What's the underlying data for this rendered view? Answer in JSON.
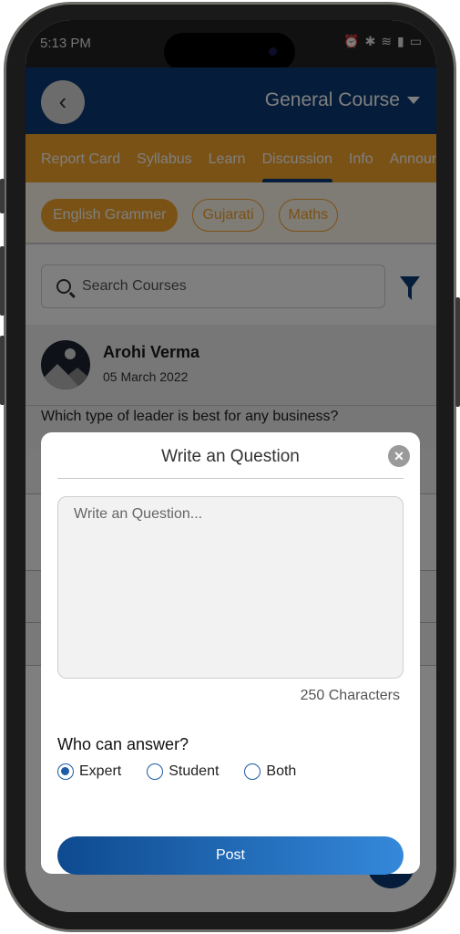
{
  "status_bar": {
    "time": "5:13 PM",
    "icons": [
      "alarm-icon",
      "bluetooth-icon",
      "wifi-icon",
      "signal-icon",
      "battery-icon"
    ]
  },
  "header": {
    "back_icon": "chevron-left-icon",
    "course_title": "General Course",
    "dropdown_icon": "caret-down-icon"
  },
  "tabs": [
    {
      "label": "Report Card",
      "active": false
    },
    {
      "label": "Syllabus",
      "active": false
    },
    {
      "label": "Learn",
      "active": false
    },
    {
      "label": "Discussion",
      "active": true
    },
    {
      "label": "Info",
      "active": false
    },
    {
      "label": "Announcements",
      "active": false
    }
  ],
  "subject_chips": [
    {
      "label": "English Grammer",
      "active": true
    },
    {
      "label": "Gujarati",
      "active": false
    },
    {
      "label": "Maths",
      "active": false
    }
  ],
  "search": {
    "placeholder": "Search Courses",
    "filter_icon": "filter-icon"
  },
  "post": {
    "author": "Arohi Verma",
    "date": "05 March 2022",
    "question": "Which type of leader is best for any business?"
  },
  "modal": {
    "title": "Write an Question",
    "close_icon": "close-icon",
    "textarea_placeholder": "Write an Question...",
    "textarea_value": "",
    "char_limit_label": "250 Characters",
    "who_label": "Who can answer?",
    "options": [
      {
        "label": "Expert",
        "checked": true
      },
      {
        "label": "Student",
        "checked": false
      },
      {
        "label": "Both",
        "checked": false
      }
    ],
    "submit_label": "Post"
  },
  "colors": {
    "primary": "#0b3b74",
    "accent": "#f4a52a",
    "button_gradient_start": "#0e4a8f",
    "button_gradient_end": "#3488da"
  }
}
